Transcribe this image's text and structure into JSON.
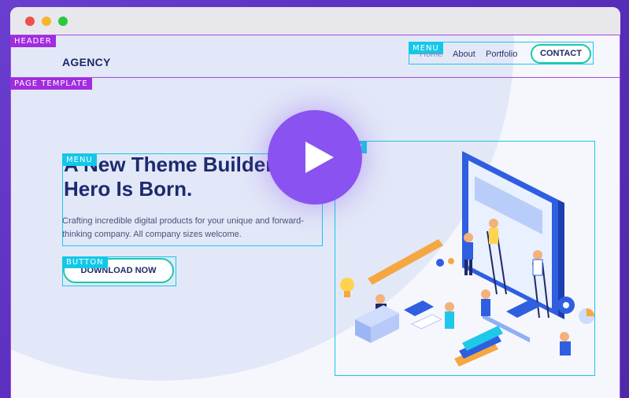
{
  "header": {
    "tag": "HEADER",
    "logo": "AGENCY",
    "menu_tag": "MENU",
    "nav": [
      "Home",
      "About",
      "Portfolio"
    ],
    "contact_label": "CONTACT"
  },
  "page_template": {
    "tag": "PAGE TEMPLATE"
  },
  "hero": {
    "menu_tag": "MENU",
    "title_line1": "A New Theme Builder",
    "title_line2": "Hero Is Born.",
    "description": "Crafting incredible digital products for your unique and forward-thinking company. All company sizes welcome.",
    "button_tag": "BUTTON",
    "button_label": "DOWNLOAD NOW",
    "image_tag": "IMAGE"
  },
  "colors": {
    "accent": "#8a52f0",
    "tag_purple": "#a12ce0",
    "tag_cyan": "#12c8e8",
    "button_border": "#1fc8a8",
    "navy": "#1e2a6e"
  },
  "icons": [
    "play-icon"
  ]
}
